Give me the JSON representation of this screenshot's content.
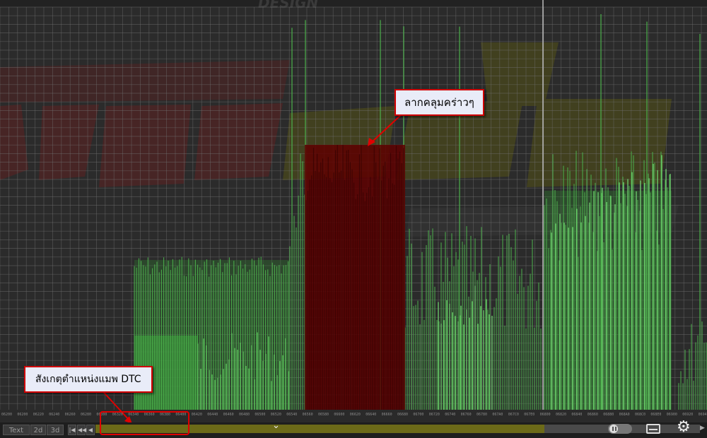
{
  "overlay_logo_text": "DESIGN",
  "callouts": {
    "drag_select": "ลากคลุมคร่าวๆ",
    "observe_dtc": "สังเกตุตำแหน่งแมพ DTC"
  },
  "view_buttons": {
    "text": "Text",
    "two_d": "2d",
    "three_d": "3d"
  },
  "nav_icons": [
    "skip-start-icon",
    "step-back-icon",
    "step-back-small-icon"
  ],
  "address_ticks": [
    "06200",
    "06200",
    "06220",
    "06240",
    "06260",
    "06280",
    "06300",
    "06320",
    "06340",
    "06360",
    "06380",
    "06400",
    "06420",
    "06440",
    "06460",
    "06480",
    "06500",
    "06520",
    "06540",
    "06560",
    "06580",
    "06600",
    "06620",
    "06640",
    "06660",
    "06680",
    "06700",
    "06720",
    "06740",
    "06760",
    "06780",
    "067A0",
    "067C0",
    "067E0",
    "06800",
    "06820",
    "06840",
    "06860",
    "06880",
    "068A0",
    "068C0",
    "068E0",
    "06900",
    "06920",
    "06940"
  ],
  "player_controls": {
    "pause": "pause-toggle-icon",
    "captions": "captions-icon",
    "settings": "gear-icon",
    "chevron": "chevron-down-icon"
  },
  "colors": {
    "background": "#2a2a2a",
    "grid": "#7a7a7a",
    "data_green": "#3ea63e",
    "selection_red": "#6e0000",
    "callout_border": "#d00000",
    "timeline_yellow": "#6c6a18"
  }
}
